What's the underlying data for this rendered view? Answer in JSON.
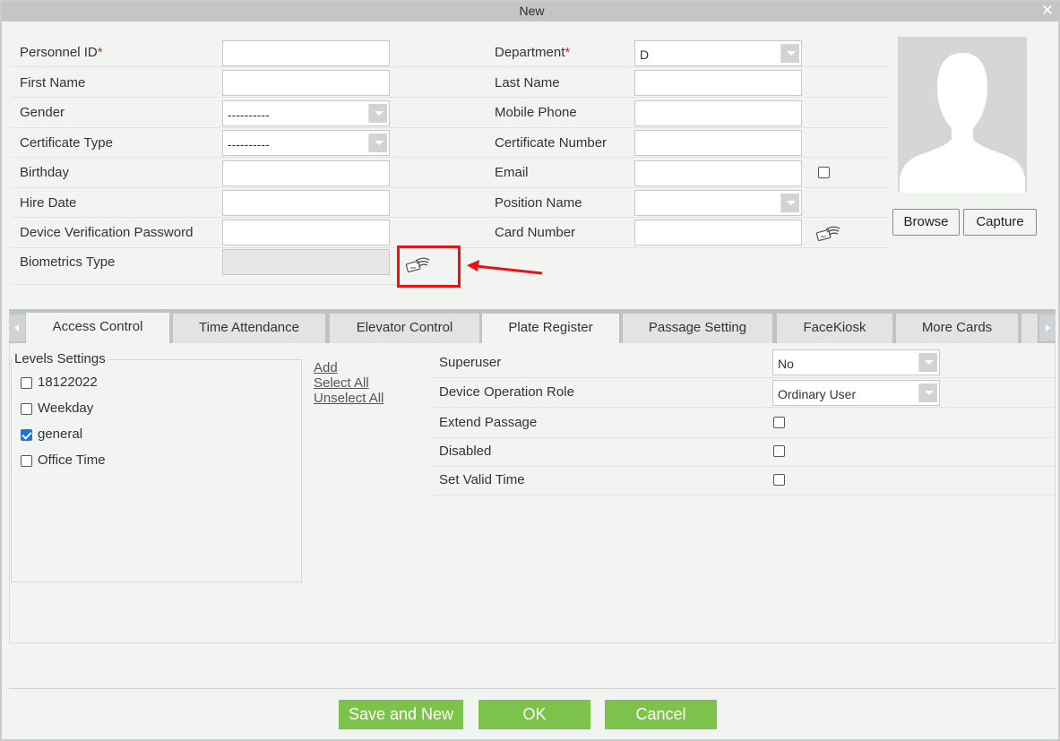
{
  "dialog": {
    "title": "New"
  },
  "form": {
    "personnel_id": {
      "label": "Personnel ID",
      "required_mark": "*",
      "value": ""
    },
    "department": {
      "label": "Department",
      "required_mark": "*",
      "value": "D"
    },
    "first_name": {
      "label": "First Name",
      "value": ""
    },
    "last_name": {
      "label": "Last Name",
      "value": ""
    },
    "gender": {
      "label": "Gender",
      "value": "----------"
    },
    "mobile_phone": {
      "label": "Mobile Phone",
      "value": ""
    },
    "certificate_type": {
      "label": "Certificate Type",
      "value": "----------"
    },
    "certificate_number": {
      "label": "Certificate Number",
      "value": ""
    },
    "birthday": {
      "label": "Birthday",
      "value": ""
    },
    "email": {
      "label": "Email",
      "value": "",
      "checked": false
    },
    "hire_date": {
      "label": "Hire Date",
      "value": ""
    },
    "position_name": {
      "label": "Position Name",
      "value": ""
    },
    "device_verification_password": {
      "label": "Device Verification Password",
      "value": ""
    },
    "card_number": {
      "label": "Card Number",
      "value": ""
    },
    "biometrics_type": {
      "label": "Biometrics Type",
      "value": ""
    }
  },
  "photo": {
    "browse_label": "Browse",
    "capture_label": "Capture"
  },
  "tabs": [
    {
      "label": "Access Control",
      "active": true
    },
    {
      "label": "Time Attendance",
      "active": false
    },
    {
      "label": "Elevator Control",
      "active": false
    },
    {
      "label": "Plate Register",
      "active": false
    },
    {
      "label": "Passage Setting",
      "active": false
    },
    {
      "label": "FaceKiosk",
      "active": false
    },
    {
      "label": "More Cards",
      "active": false
    }
  ],
  "access_control": {
    "levels_title": "Levels Settings",
    "levels": [
      {
        "label": "18122022",
        "checked": false
      },
      {
        "label": "Weekday",
        "checked": false
      },
      {
        "label": "general",
        "checked": true
      },
      {
        "label": "Office Time",
        "checked": false
      }
    ],
    "links": {
      "add": "Add",
      "select_all": "Select All",
      "unselect_all": "Unselect All"
    },
    "superuser": {
      "label": "Superuser",
      "value": "No"
    },
    "device_operation_role": {
      "label": "Device Operation Role",
      "value": "Ordinary User"
    },
    "extend_passage": {
      "label": "Extend Passage",
      "checked": false
    },
    "disabled": {
      "label": "Disabled",
      "checked": false
    },
    "set_valid_time": {
      "label": "Set Valid Time",
      "checked": false
    }
  },
  "footer": {
    "save_and_new": "Save and New",
    "ok": "OK",
    "cancel": "Cancel"
  },
  "colors": {
    "accent_green": "#7dc24b",
    "required_red": "#e02020",
    "highlight_red": "#ee1111",
    "checkbox_blue": "#1a73e8"
  },
  "icons": [
    "close-icon",
    "fingerprint-card-icon",
    "avatar-silhouette-icon",
    "chevron-down-icon",
    "arrow-left-icon",
    "arrow-right-icon"
  ]
}
